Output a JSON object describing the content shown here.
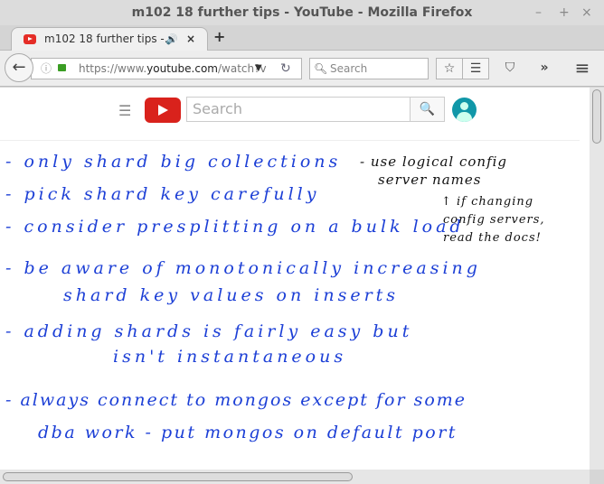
{
  "window": {
    "title": "m102 18 further tips - YouTube - Mozilla Firefox",
    "minimize": "–",
    "maximize": "+",
    "close": "×"
  },
  "tab": {
    "title": "m102 18 further tips -...",
    "audio": "🔊",
    "close": "×",
    "new_tab": "+"
  },
  "nav": {
    "back": "←",
    "url_prefix": "https://www.",
    "url_domain": "youtube.com",
    "url_rest": "/watch?v",
    "dropdown": "▼",
    "reload": "↻",
    "search_placeholder": "Search",
    "bookmark": "☆",
    "reader": "☰",
    "pocket": "⛉",
    "overflow": "»",
    "menu": "≡"
  },
  "youtube": {
    "menu": "☰",
    "search_placeholder": "Search",
    "search_icon": "🔍"
  },
  "notes": {
    "lines": [
      "- only shard big collections",
      "- pick shard key carefully",
      "- consider presplitting on a bulk load",
      "- be aware of monotonically increasing",
      "shard key values on inserts",
      "- adding shards is fairly easy but",
      "isn't instantaneous",
      "- always connect to mongos except for some",
      "dba work - put mongos on default port"
    ],
    "side": [
      "- use logical config",
      "server names",
      "↑ if changing",
      "config servers,",
      "read the docs!"
    ]
  }
}
